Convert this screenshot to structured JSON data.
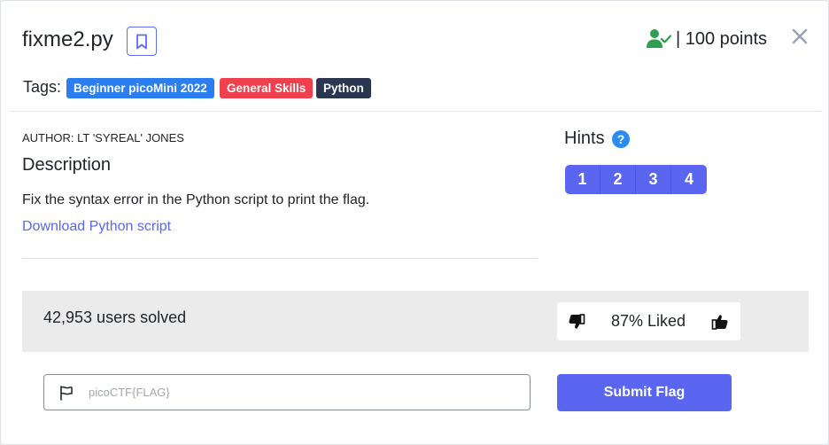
{
  "header": {
    "title": "fixme2.py",
    "points": "| 100 points"
  },
  "tags": {
    "label": "Tags:",
    "items": [
      {
        "label": "Beginner picoMini 2022",
        "color": "#2a7ef0"
      },
      {
        "label": "General Skills",
        "color": "#f0404d"
      },
      {
        "label": "Python",
        "color": "#2b3650"
      }
    ]
  },
  "description": {
    "author": "AUTHOR: LT 'SYREAL' JONES",
    "heading": "Description",
    "text": "Fix the syntax error in the Python script to print the flag.",
    "link": "Download Python script"
  },
  "hints": {
    "heading": "Hints",
    "info": "?",
    "buttons": [
      "1",
      "2",
      "3",
      "4"
    ]
  },
  "stats": {
    "solved": "42,953 users solved",
    "liked": "87% Liked"
  },
  "flag_form": {
    "placeholder": "picoCTF{FLAG}",
    "submit_label": "Submit Flag"
  },
  "colors": {
    "accent": "#5a66f0",
    "success": "#2e9e4f"
  }
}
